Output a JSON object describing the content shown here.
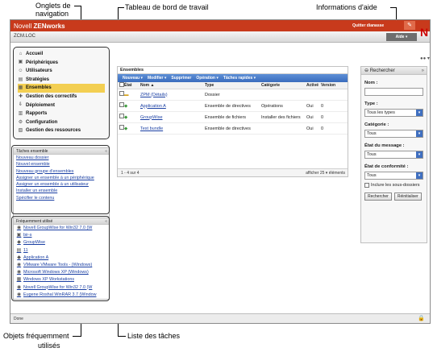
{
  "callouts": {
    "nav_tabs_line1": "Onglets de",
    "nav_tabs_line2": "navigation",
    "dashboard": "Tableau de bord de travail",
    "help_info": "Informations d'aide",
    "frequent_line1": "Objets fréquemment",
    "frequent_line2": "utilisés",
    "task_list": "Liste des tâches"
  },
  "app": {
    "brand_prefix": "Novell",
    "brand_name": "ZENworks",
    "zone": "ZCM.LOC",
    "exit_link": "Quitter dianasse",
    "help_button": "Aide ▾",
    "logo": "N"
  },
  "nav": {
    "items": [
      {
        "label": "Accueil",
        "icon": "home-icon",
        "glyph": "⌂"
      },
      {
        "label": "Périphériques",
        "icon": "devices-icon",
        "glyph": "▣"
      },
      {
        "label": "Utilisateurs",
        "icon": "users-icon",
        "glyph": "☺"
      },
      {
        "label": "Stratégies",
        "icon": "policies-icon",
        "glyph": "▤"
      },
      {
        "label": "Ensembles",
        "icon": "bundles-icon",
        "glyph": "▦"
      },
      {
        "label": "Gestion des correctifs",
        "icon": "patch-icon",
        "glyph": "✚"
      },
      {
        "label": "Déploiement",
        "icon": "deployment-icon",
        "glyph": "⇩"
      },
      {
        "label": "Rapports",
        "icon": "reports-icon",
        "glyph": "▥"
      },
      {
        "label": "Configuration",
        "icon": "configuration-icon",
        "glyph": "⚙"
      },
      {
        "label": "Gestion des ressources",
        "icon": "assets-icon",
        "glyph": "▧"
      }
    ],
    "selected_index": 4
  },
  "tasks": {
    "title": "Tâches ensemble",
    "items": [
      "Nouveau dossier",
      "Nouvel ensemble",
      "Nouveau groupe d'ensembles",
      "Assigner un ensemble à un périphérique",
      "Assigner un ensemble à un utilisateur",
      "Installer un ensemble",
      "Spécifier le contenu"
    ]
  },
  "frequent": {
    "title": "Fréquemment utilisé",
    "items": [
      {
        "label": "Novell GroupWise for Win32 7.0 (W",
        "glyph": "◉"
      },
      {
        "label": "bir-s",
        "glyph": "▣"
      },
      {
        "label": "GroupWise",
        "glyph": "◆"
      },
      {
        "label": "11",
        "glyph": "▤"
      },
      {
        "label": "Application A",
        "glyph": "◆"
      },
      {
        "label": "VMware VMware Tools - (Windows)",
        "glyph": "◉"
      },
      {
        "label": "Microsoft Windows XP (Windows)",
        "glyph": "◉"
      },
      {
        "label": "Windows XP Workstations",
        "glyph": "▦"
      },
      {
        "label": "Novell GroupWise for Win32 7.0 (W",
        "glyph": "◉"
      },
      {
        "label": "Eugene Roshal WinRAR 3.7 (Window",
        "glyph": "◉"
      }
    ]
  },
  "main": {
    "title": "Ensembles",
    "toolbar": [
      "Nouveau ▾",
      "Modifier ▾",
      "Supprimer",
      "Opération ▾",
      "Tâches rapides ▾"
    ],
    "columns": [
      "État",
      "Nom ▲",
      "Type",
      "Catégorie",
      "Activé",
      "Version"
    ],
    "rows": [
      {
        "name": "ZPM (Détails)",
        "type": "Dossier",
        "category": "",
        "enabled": "",
        "version": ""
      },
      {
        "name": "Application A",
        "type": "Ensemble de directives",
        "category": "Opérations",
        "enabled": "Oui",
        "version": "0"
      },
      {
        "name": "GroupWise",
        "type": "Ensemble de fichiers",
        "category": "Installer des fichiers",
        "enabled": "Oui",
        "version": "0"
      },
      {
        "name": "Test bundle",
        "type": "Ensemble de directives",
        "category": "",
        "enabled": "Oui",
        "version": "0"
      }
    ],
    "pager_left": "1 - 4 sur 4",
    "pager_right": "afficher  25 ▾  éléments"
  },
  "search": {
    "title": "Rechercher",
    "name_label": "Nom :",
    "type_label": "Type :",
    "type_value": "Tous les types",
    "category_label": "Catégorie :",
    "category_value": "Tous",
    "message_label": "État du message :",
    "message_value": "Tous",
    "compliance_label": "État de conformité :",
    "compliance_value": "Tous",
    "include_sub": "Inclure les sous-dossiers",
    "search_btn": "Rechercher",
    "reset_btn": "Réinitialiser"
  },
  "status": {
    "text": "Done"
  }
}
